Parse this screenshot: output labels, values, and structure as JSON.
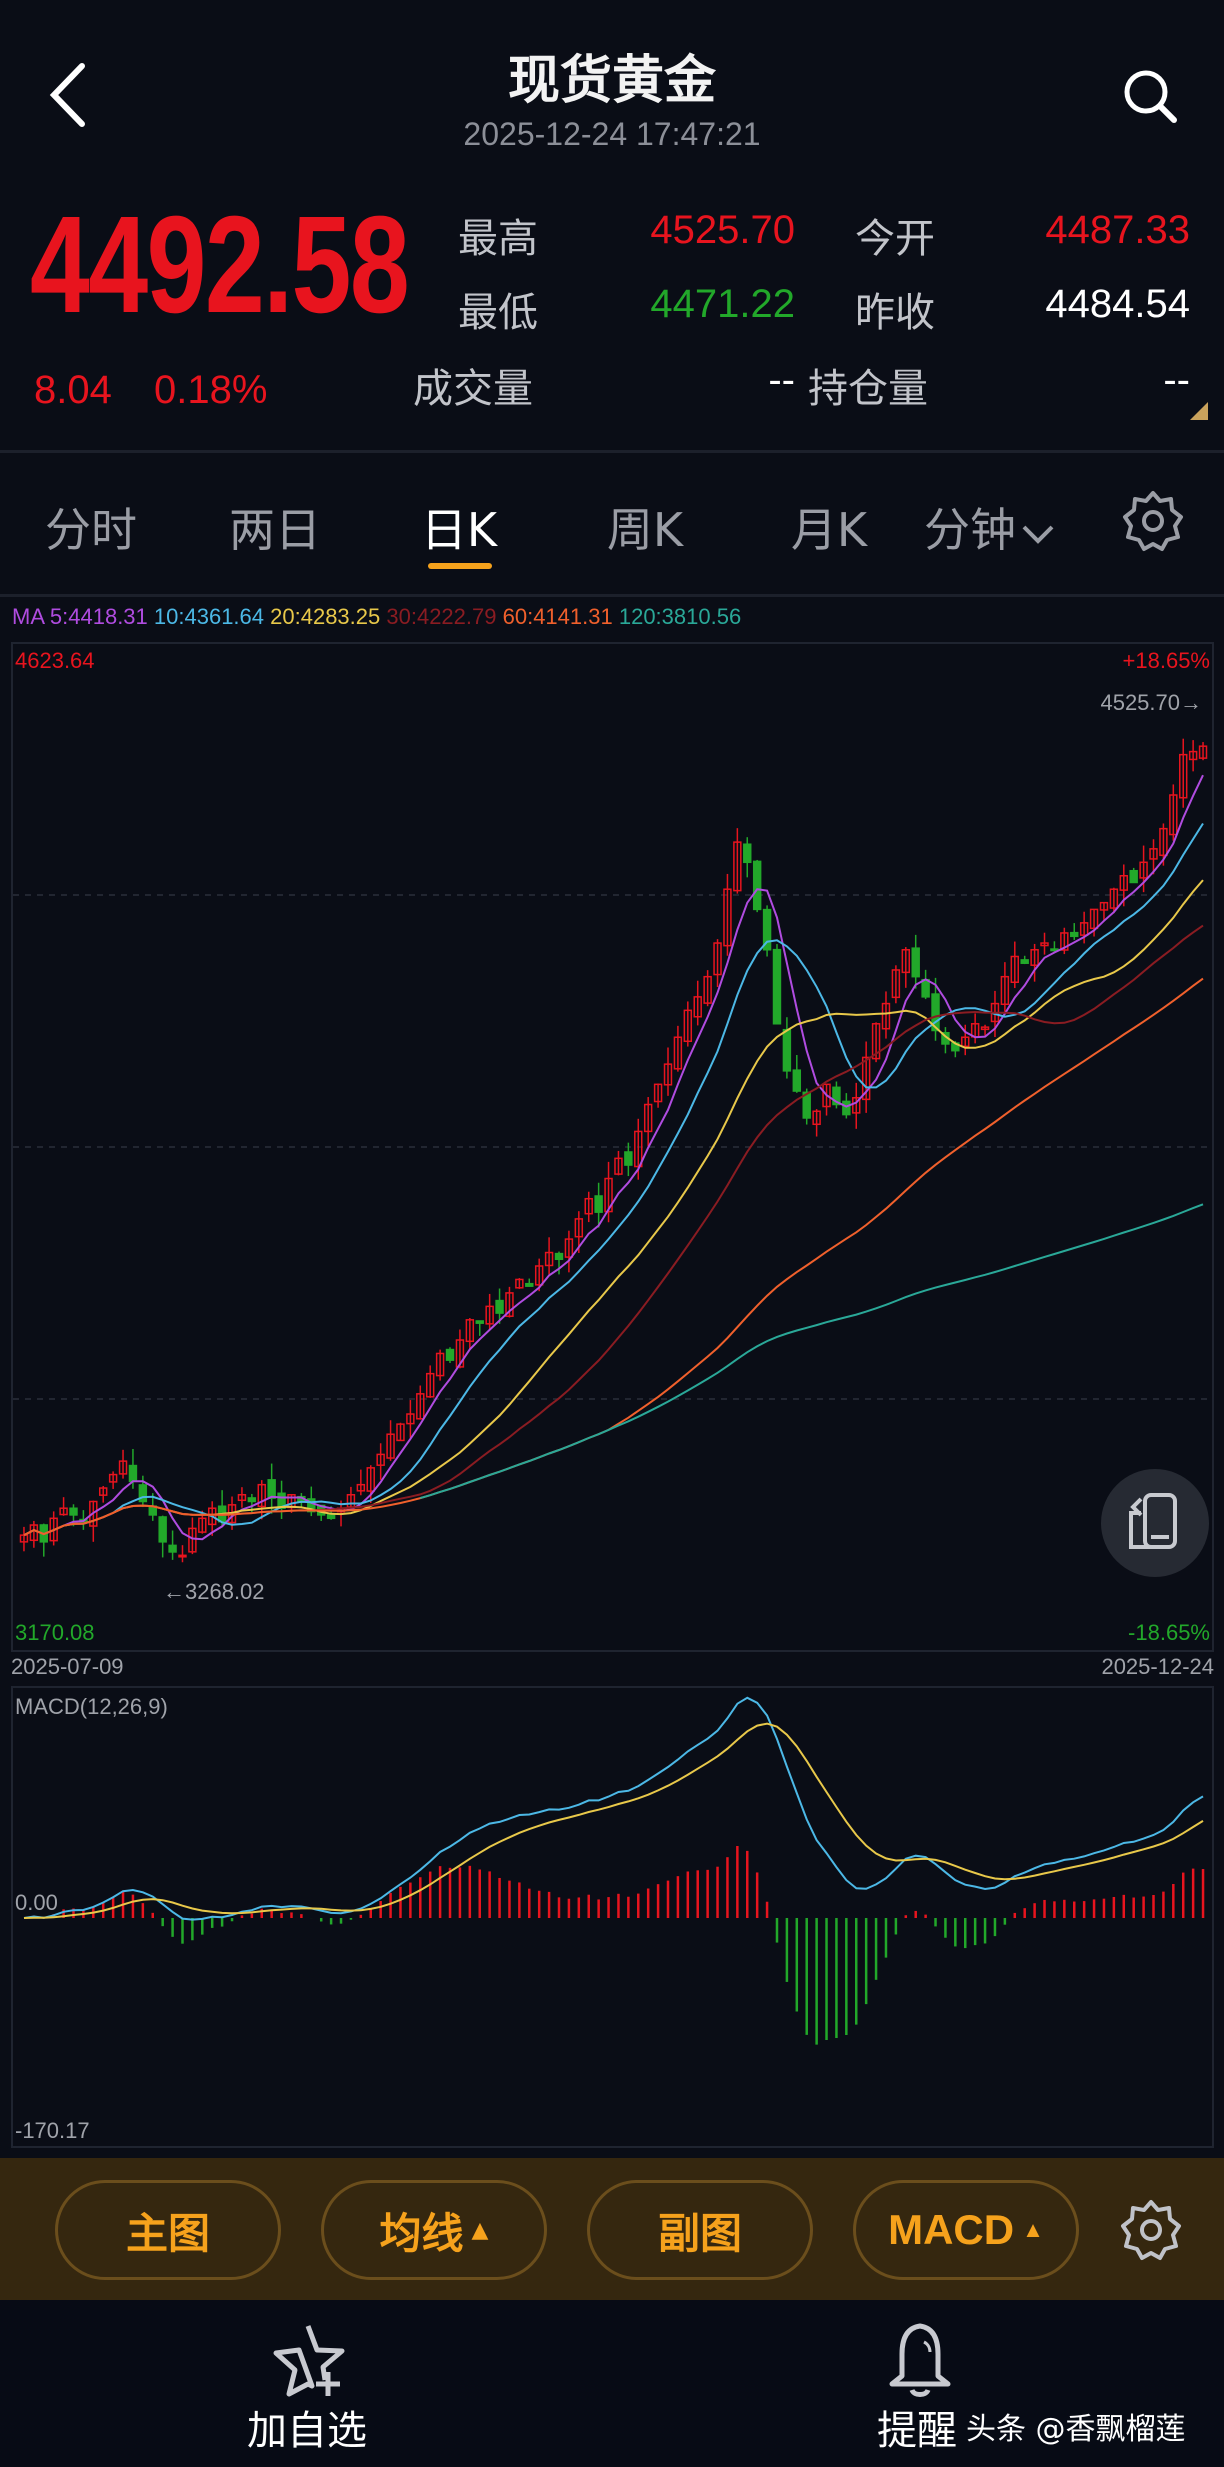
{
  "header": {
    "title": "现货黄金",
    "datetime": "2025-12-24 17:47:21",
    "back_icon": "chevron-left-icon",
    "search_icon": "search-icon"
  },
  "quote": {
    "price": "4492.58",
    "change": "8.04",
    "change_pct": "0.18%",
    "high_label": "最高",
    "high": "4525.70",
    "open_label": "今开",
    "open": "4487.33",
    "low_label": "最低",
    "low": "4471.22",
    "prev_close_label": "昨收",
    "prev_close": "4484.54",
    "volume_label": "成交量",
    "volume": "--",
    "open_interest_label": "持仓量",
    "open_interest": "--"
  },
  "tabs": [
    {
      "label": "分时"
    },
    {
      "label": "两日"
    },
    {
      "label": "日K",
      "active": true
    },
    {
      "label": "周K"
    },
    {
      "label": "月K"
    },
    {
      "label": "分钟"
    }
  ],
  "ma_legend": {
    "ma5": "MA 5:4418.31",
    "ma10": "10:4361.64",
    "ma20": "20:4283.25",
    "ma30": "30:4222.79",
    "ma60": "60:4141.31",
    "ma120": "120:3810.56"
  },
  "colors": {
    "up": "#e8141e",
    "down": "#22a82a",
    "ma5": "#b04ce0",
    "ma10": "#4cb8e6",
    "ma20": "#e8c84a",
    "ma30": "#8a1c22",
    "ma60": "#f0602c",
    "ma120": "#2aa898",
    "dif": "#4cb8e6",
    "dea": "#e8c84a",
    "accent": "#f6a21c"
  },
  "chart_data": [
    {
      "type": "candlestick",
      "title": "日K",
      "ylim": [
        3170.08,
        4623.64
      ],
      "y_top_label": "4623.64",
      "y_bottom_label": "3170.08",
      "pct_top": "+18.65%",
      "pct_bottom": "-18.65%",
      "x_start": "2025-07-09",
      "x_end": "2025-12-24",
      "high_marker": "4525.70→",
      "low_marker": "←3268.02",
      "closes": [
        3320,
        3335,
        3310,
        3345,
        3360,
        3350,
        3340,
        3370,
        3390,
        3410,
        3430,
        3400,
        3370,
        3350,
        3310,
        3295,
        3290,
        3330,
        3345,
        3360,
        3340,
        3365,
        3380,
        3370,
        3395,
        3375,
        3360,
        3380,
        3370,
        3355,
        3350,
        3345,
        3360,
        3380,
        3395,
        3420,
        3440,
        3470,
        3485,
        3500,
        3530,
        3560,
        3590,
        3580,
        3610,
        3640,
        3635,
        3660,
        3650,
        3680,
        3700,
        3690,
        3720,
        3740,
        3730,
        3760,
        3790,
        3820,
        3800,
        3850,
        3880,
        3870,
        3920,
        3960,
        3990,
        4020,
        4060,
        4100,
        4120,
        4150,
        4200,
        4280,
        4350,
        4320,
        4250,
        4190,
        4080,
        4010,
        3980,
        3940,
        3950,
        3990,
        3960,
        3945,
        3970,
        4030,
        4080,
        4110,
        4160,
        4190,
        4150,
        4120,
        4070,
        4050,
        4040,
        4060,
        4080,
        4075,
        4110,
        4150,
        4180,
        4170,
        4190,
        4200,
        4190,
        4215,
        4210,
        4230,
        4250,
        4260,
        4280,
        4300,
        4290,
        4320,
        4340,
        4370,
        4420,
        4480,
        4484.54,
        4492.58
      ],
      "ma_periods": [
        5,
        10,
        20,
        30,
        60,
        120
      ]
    },
    {
      "type": "macd",
      "title": "MACD(12,26,9)",
      "zero_label": "0.00",
      "bottom_label": "-170.17",
      "ylim": [
        -170.17,
        170.17
      ]
    }
  ],
  "toolbar": {
    "main_chart": "主图",
    "ma": "均线",
    "sub_chart": "副图",
    "indicator": "MACD",
    "up_arrow": "▲"
  },
  "bottom_nav": {
    "add_watchlist": "加自选",
    "alert": "提醒",
    "watermark": "头条 @香飘榴莲"
  }
}
